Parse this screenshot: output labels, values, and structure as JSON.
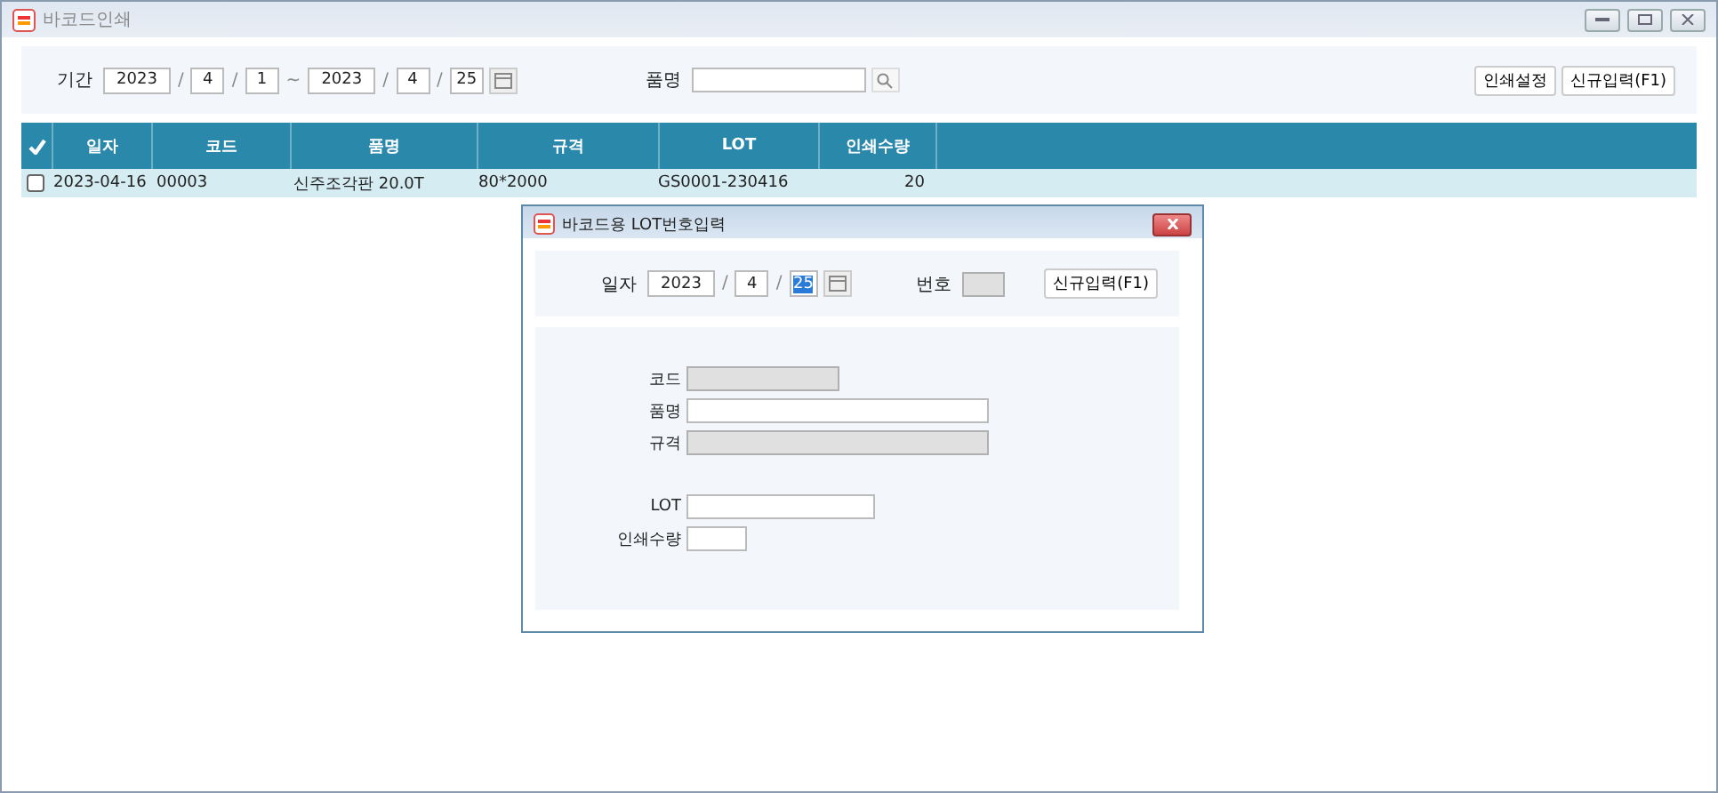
{
  "window": {
    "title": "바코드인쇄"
  },
  "filter": {
    "period_label": "기간",
    "from": {
      "year": "2023",
      "sep1": "/",
      "month": "4",
      "sep2": "/",
      "day": "1"
    },
    "range_sep": "~",
    "to": {
      "year": "2023",
      "sep1": "/",
      "month": "4",
      "sep2": "/",
      "day": "25"
    },
    "item_label": "품명",
    "buttons": [
      "인쇄설정",
      "신규입력(F1)"
    ]
  },
  "table": {
    "columns": [
      "일자",
      "코드",
      "품명",
      "규격",
      "LOT",
      "인쇄수량"
    ],
    "rows": [
      {
        "checked": false,
        "cells": [
          "2023-04-16",
          "00003",
          "신주조각판 20.0T",
          "80*2000",
          "GS0001-230416",
          "20"
        ]
      }
    ]
  },
  "dialog": {
    "title": "바코드용 LOT번호입력",
    "date_label": "일자",
    "date": {
      "year": "2023",
      "sep1": "/",
      "month": "4",
      "sep2": "/",
      "day": "25",
      "day_selected": true
    },
    "number_label": "번호",
    "button": "신규입력(F1)",
    "fields": [
      {
        "label": "코드",
        "disabled": true
      },
      {
        "label": "품명",
        "disabled": false
      },
      {
        "label": "규격",
        "disabled": true
      },
      {
        "label": "LOT",
        "disabled": false
      },
      {
        "label": "인쇄수량",
        "disabled": false
      }
    ]
  }
}
